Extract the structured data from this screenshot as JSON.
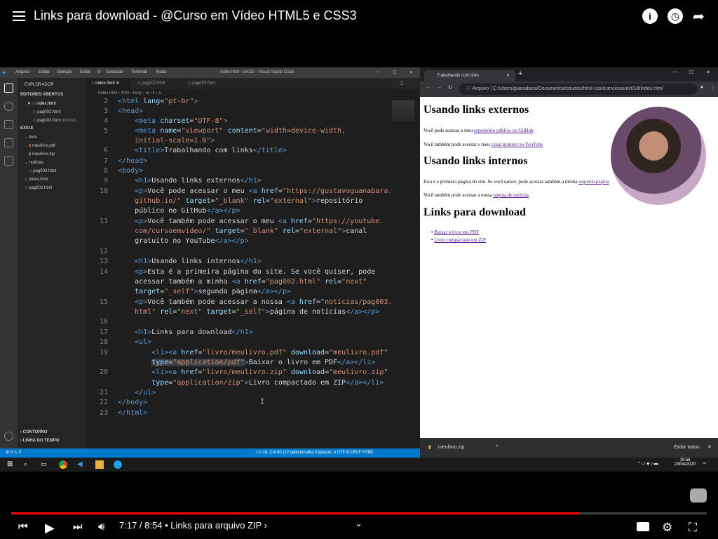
{
  "player": {
    "title": "Links para download - @Curso em Vídeo HTML5 e CSS3",
    "time_current": "7:17",
    "time_sep": " / ",
    "time_total": "8:54",
    "chapter": " • Links para arquivo ZIP ›",
    "progress_fraction": 0.818,
    "icons": [
      "menu-icon",
      "info-icon",
      "watch-later-icon",
      "share-icon",
      "previous-icon",
      "play-icon",
      "next-icon",
      "volume-icon",
      "chevron-down-icon",
      "subtitles-icon",
      "settings-icon",
      "fullscreen-exit-icon",
      "youtube-logo-icon"
    ]
  },
  "vscode": {
    "menu": [
      "Arquivo",
      "Editar",
      "Seleção",
      "Exibir",
      "Ir",
      "Executar",
      "Terminal",
      "Ajuda"
    ],
    "window_title": "index.html - ex018 - Visual Studio Code",
    "explorer_title": "EXPLORADOR",
    "open_editors_label": "EDITORES ABERTOS",
    "open_editors": [
      "index.html",
      "pag002.html",
      "pag003.html"
    ],
    "open_editor_hint": "noticias",
    "project_label": "EX018",
    "tree": [
      "livro",
      "meulivro.pdf",
      "meulivro.zip",
      "noticias",
      "pag003.html",
      "index.html",
      "pag002.html"
    ],
    "outline_label": "CONTORNO",
    "timeline_label": "LINHA DO TEMPO",
    "tabs": [
      "index.html",
      "pag002.html",
      "pag003.html"
    ],
    "breadcrumb": "index.html › html › body › ul › li › a",
    "status_left": "⊗ 0 ⚠ 0",
    "status_right": "Ln 19, Col 60 (22 selecionado)   Espaços: 4   UTF-8   CRLF   HTML",
    "line_numbers": [
      "2",
      "3",
      "4",
      "5",
      "",
      "6",
      "7",
      "8",
      "9",
      "10",
      "",
      "",
      "11",
      "",
      "",
      "12",
      "13",
      "14",
      "",
      "",
      "15",
      "",
      "16",
      "17",
      "18",
      "19",
      "",
      "20",
      "",
      "21",
      "22",
      "23"
    ]
  },
  "browser": {
    "tab_title": "Trabalhando com links",
    "url_prefix": "Arquivo",
    "url": "C:/Users/guanabara/Documents/estudos/html-css/exercicios/ex018/index.html",
    "h1_externos": "Usando links externos",
    "p1": "Você pode acessar o meu ",
    "p1_link": "repositório público no GitHub",
    "p2": "Você também pode acessar o meu ",
    "p2_link": "canal gratuito no YouTube",
    "h1_internos": "Usando links internos",
    "p3": "Esta é a primeira página do site. Se você quiser, pode acessar também a minha ",
    "p3_link": "segunda página",
    "p4": "Você também pode acessar a nossa ",
    "p4_link": "página de notícias",
    "h1_download": "Links para download",
    "li1": "Baixar o livro em PDF",
    "li2": "Livro compactado em ZIP",
    "download_file": "meulivro.zip",
    "download_show_all": "Exibir todos"
  },
  "taskbar": {
    "clock_time": "15:56",
    "clock_date": "23/04/2020"
  }
}
